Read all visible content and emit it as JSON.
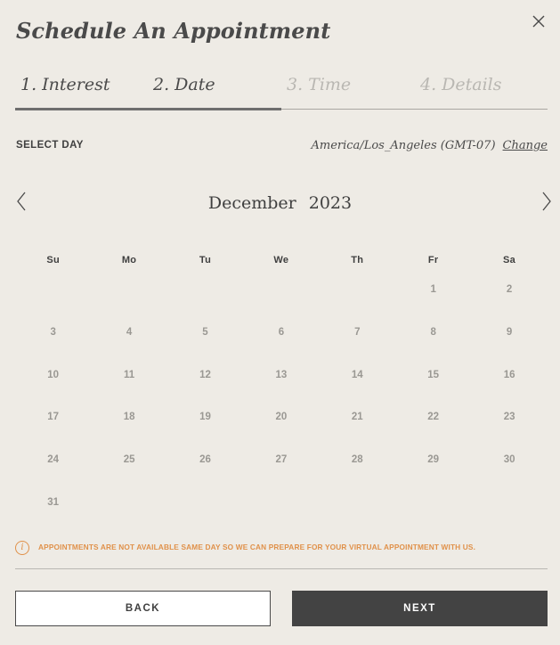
{
  "modal": {
    "title": "Schedule An Appointment"
  },
  "steps": [
    {
      "label": "1. Interest",
      "state": "completed"
    },
    {
      "label": "2. Date",
      "state": "active"
    },
    {
      "label": "3. Time",
      "state": "upcoming"
    },
    {
      "label": "4. Details",
      "state": "upcoming"
    }
  ],
  "section": {
    "select_day_label": "SELECT DAY",
    "timezone": "America/Los_Angeles (GMT-07)",
    "change_label": "Change"
  },
  "calendar": {
    "month": "December",
    "year": "2023",
    "weekdays": [
      "Su",
      "Mo",
      "Tu",
      "We",
      "Th",
      "Fr",
      "Sa"
    ],
    "first_weekday_index": 5,
    "days": [
      "1",
      "2",
      "3",
      "4",
      "5",
      "6",
      "7",
      "8",
      "9",
      "10",
      "11",
      "12",
      "13",
      "14",
      "15",
      "16",
      "17",
      "18",
      "19",
      "20",
      "21",
      "22",
      "23",
      "24",
      "25",
      "26",
      "27",
      "28",
      "29",
      "30",
      "31"
    ]
  },
  "notice": {
    "icon": "info-icon",
    "icon_glyph": "i",
    "text": "APPOINTMENTS ARE NOT AVAILABLE SAME DAY SO WE CAN PREPARE FOR YOUR VIRTUAL APPOINTMENT WITH US."
  },
  "actions": {
    "back_label": "BACK",
    "next_label": "NEXT"
  },
  "colors": {
    "background": "#eeebe5",
    "text": "#3f3f3f",
    "muted": "#9a9893",
    "accent": "#e0914a",
    "primary_button": "#434343"
  }
}
